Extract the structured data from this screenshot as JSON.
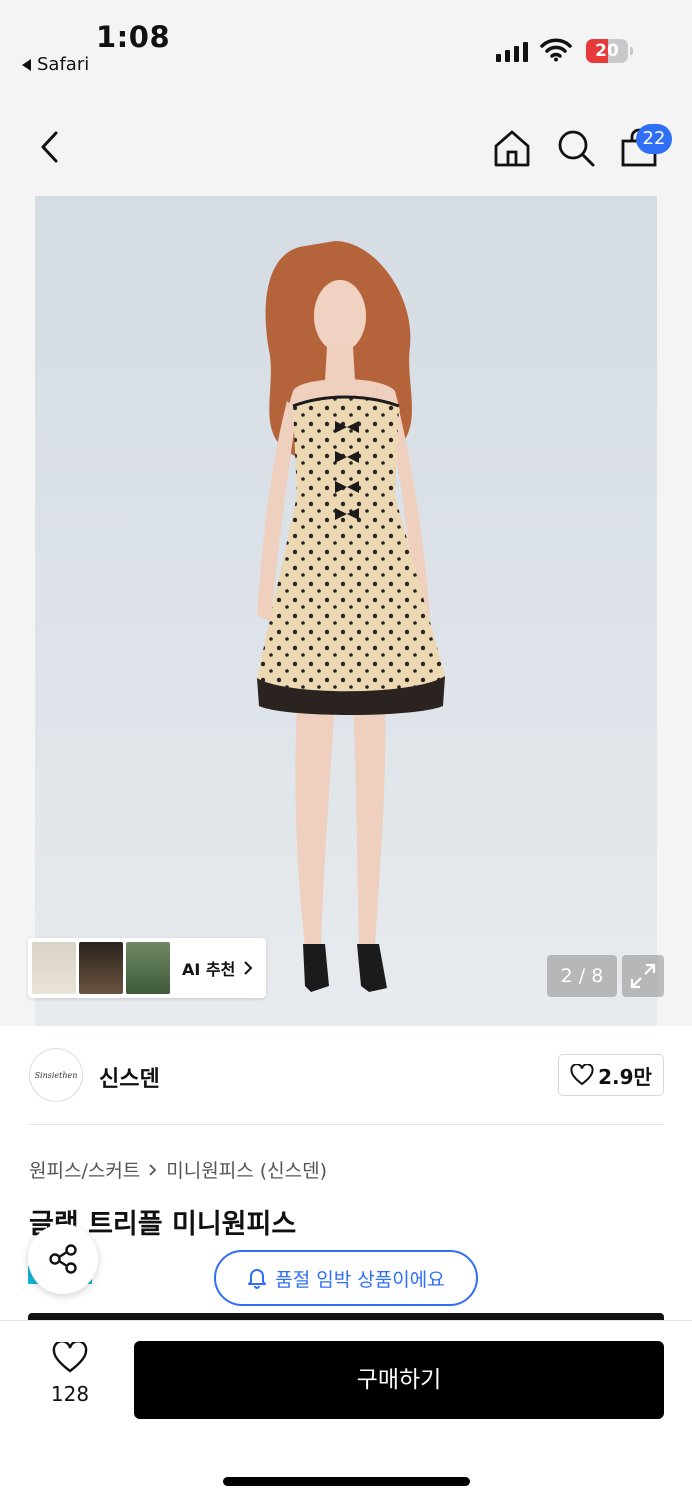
{
  "status": {
    "time": "1:08",
    "back_app": "Safari",
    "battery": "20"
  },
  "nav": {
    "cart_count": "22"
  },
  "gallery": {
    "pager": "2 / 8",
    "ai_label": "AI 추천",
    "dress_color": "#ecd9b4"
  },
  "brand": {
    "name": "신스덴",
    "logo_text": "Sinsiethen",
    "likes": "2.9만"
  },
  "breadcrumb": {
    "category": "원피스/스커트",
    "subcategory": "미니원피스 (신스덴)"
  },
  "product": {
    "title": "글램 트리플 미니원피스"
  },
  "notice": {
    "soldout_text": "품절 임박 상품이에요"
  },
  "bottom": {
    "wish_count": "128",
    "buy_label": "구매하기"
  },
  "colors": {
    "accent": "#2f6ff5",
    "buy": "#000000"
  }
}
